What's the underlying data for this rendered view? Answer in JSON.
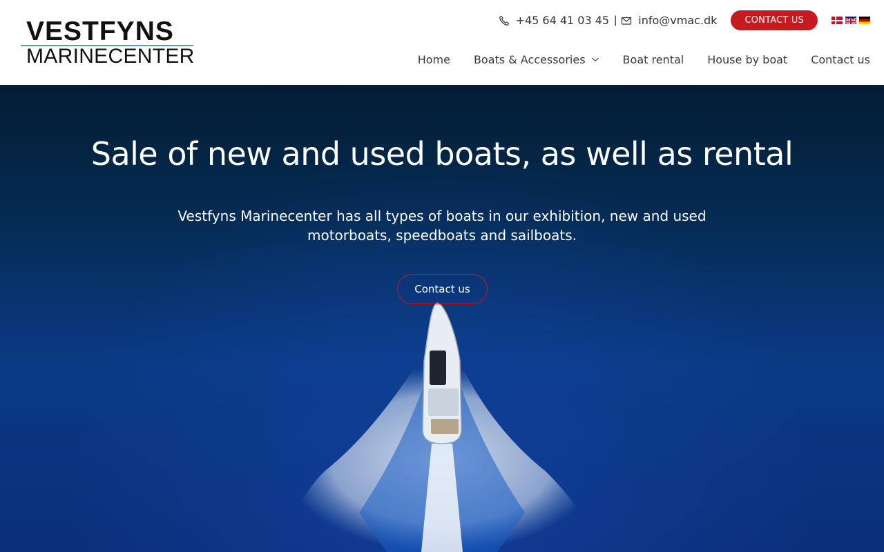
{
  "logo": {
    "line1": "VESTFYNS",
    "line2": "MARINECENTER"
  },
  "topbar": {
    "phone": "+45 64 41 03 45",
    "separator": "|",
    "email": "info@vmac.dk",
    "cta_label": "CONTACT US",
    "languages": [
      "Danish",
      "English",
      "German"
    ]
  },
  "nav": {
    "items": [
      {
        "label": "Home"
      },
      {
        "label": "Boats & Accessories"
      },
      {
        "label": "Boat rental"
      },
      {
        "label": "House by boat"
      },
      {
        "label": "Contact us"
      }
    ]
  },
  "hero": {
    "title": "Sale of new and used boats, as well as rental",
    "subtitle": "Vestfyns Marinecenter has all types of boats in our exhibition, new and used motorboats, speedboats and sailboats.",
    "button_label": "Contact us"
  },
  "colors": {
    "accent": "#c8191e",
    "nav_text": "#3a3a3a",
    "hero_deep": "#031d33",
    "hero_sea": "#0a3a84"
  }
}
